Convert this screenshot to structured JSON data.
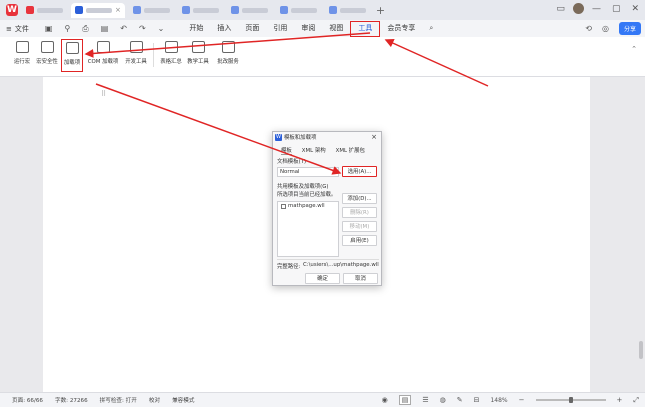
{
  "app": {
    "logo_text": "W",
    "menu_file": "文件",
    "menus": [
      "开始",
      "插入",
      "页面",
      "引用",
      "审阅",
      "视图",
      "工具",
      "会员专享"
    ],
    "selected_menu": "工具",
    "share": "分享",
    "add_tab": "+"
  },
  "toolbar": {
    "tools": [
      "运行宏",
      "宏安全性",
      "加载项",
      "COM 加载项",
      "开发工具",
      "表格汇总",
      "教学工具",
      "批改服务"
    ],
    "highlighted": "加载项"
  },
  "dialog": {
    "title": "模板和加载项",
    "tabs": [
      "模板",
      "XML 架构",
      "XML 扩展包"
    ],
    "template_label": "文档模板(T)",
    "template_value": "Normal",
    "select_button": "选用(A)...",
    "shared_label": "共用模板及加载项(G)",
    "checked_label": "所选项目当前已经加载。",
    "items": [
      "mathpage.wll"
    ],
    "add_button": "添加(D)...",
    "remove_button": "删除(R)",
    "move_button": "移动(M)",
    "enable_button": "启用(E)",
    "path_label": "完整路径:",
    "path_value": "C:\\usiers\\...up\\mathpage.wll",
    "ok_button": "确定",
    "cancel_button": "取消"
  },
  "status": {
    "page": "页面: 66/66",
    "words": "字数: 27266",
    "spell": "拼写检查: 打开",
    "proof": "校对",
    "compat": "兼容模式",
    "zoom": "148%",
    "zoom_minus": "−",
    "zoom_plus": "+"
  },
  "colors": {
    "accent": "#2b5fd9",
    "highlight": "#e02525",
    "share": "#3478f6"
  }
}
